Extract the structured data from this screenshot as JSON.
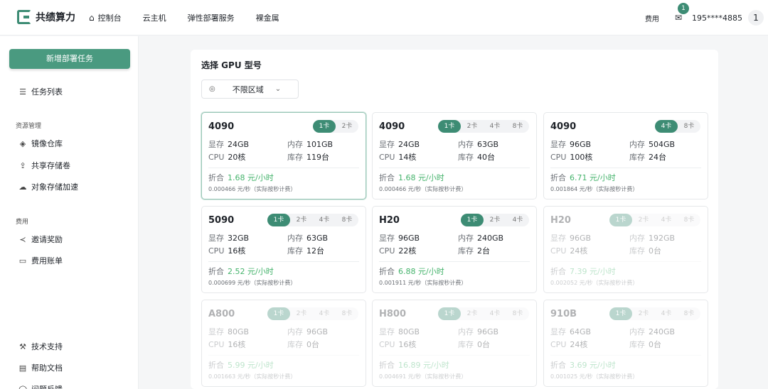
{
  "brand": {
    "name": "共绩算力"
  },
  "nav": [
    {
      "label": "控制台",
      "icon": "home-icon"
    },
    {
      "label": "云主机"
    },
    {
      "label": "弹性部署服务"
    },
    {
      "label": "裸金属"
    }
  ],
  "header": {
    "fee_link": "费用",
    "mail_badge": "1",
    "phone": "195****4885",
    "avatar_text": "1"
  },
  "sidebar": {
    "new_button": "新增部署任务",
    "task_list": "任务列表",
    "section_resources": "资源管理",
    "items_resources": [
      "镜像仓库",
      "共享存储卷",
      "对象存储加速"
    ],
    "section_fees": "费用",
    "items_fees": [
      "邀请奖励",
      "费用账单"
    ],
    "bottom_items": [
      "技术支持",
      "帮助文档",
      "问题反馈"
    ]
  },
  "main": {
    "title": "选择 GPU 型号",
    "region_value": "不限区域",
    "labels": {
      "vram": "显存",
      "mem": "内存",
      "cpu": "CPU",
      "stock": "库存",
      "discount": "折合"
    },
    "cards": [
      {
        "name": "4090",
        "pills": [
          "1卡",
          "2卡"
        ],
        "active": 0,
        "vram": "24GB",
        "mem": "101GB",
        "cpu": "20核",
        "stock": "119台",
        "price": "1.68 元/小时",
        "sub": "0.000466 元/秒（实际按秒计费）",
        "selected": true,
        "disabled": false
      },
      {
        "name": "4090",
        "pills": [
          "1卡",
          "2卡",
          "4卡",
          "8卡"
        ],
        "active": 0,
        "vram": "24GB",
        "mem": "63GB",
        "cpu": "14核",
        "stock": "40台",
        "price": "1.68 元/小时",
        "sub": "0.000466 元/秒（实际按秒计费）",
        "selected": false,
        "disabled": false
      },
      {
        "name": "4090",
        "pills": [
          "4卡",
          "8卡"
        ],
        "active": 0,
        "vram": "96GB",
        "mem": "504GB",
        "cpu": "100核",
        "stock": "24台",
        "price": "6.71 元/小时",
        "sub": "0.001864 元/秒（实际按秒计费）",
        "selected": false,
        "disabled": false
      },
      {
        "name": "5090",
        "pills": [
          "1卡",
          "2卡",
          "4卡",
          "8卡"
        ],
        "active": 0,
        "vram": "32GB",
        "mem": "63GB",
        "cpu": "16核",
        "stock": "12台",
        "price": "2.52 元/小时",
        "sub": "0.000699 元/秒（实际按秒计费）",
        "selected": false,
        "disabled": false
      },
      {
        "name": "H20",
        "pills": [
          "1卡",
          "2卡",
          "4卡"
        ],
        "active": 0,
        "vram": "96GB",
        "mem": "240GB",
        "cpu": "22核",
        "stock": "2台",
        "price": "6.88 元/小时",
        "sub": "0.001911 元/秒（实际按秒计费）",
        "selected": false,
        "disabled": false
      },
      {
        "name": "H20",
        "pills": [
          "1卡",
          "2卡",
          "4卡",
          "8卡"
        ],
        "active": 0,
        "vram": "96GB",
        "mem": "192GB",
        "cpu": "24核",
        "stock": "0台",
        "price": "7.39 元/小时",
        "sub": "0.002052 元/秒（实际按秒计费）",
        "selected": false,
        "disabled": true
      },
      {
        "name": "A800",
        "pills": [
          "1卡",
          "2卡",
          "4卡",
          "8卡"
        ],
        "active": 0,
        "vram": "80GB",
        "mem": "96GB",
        "cpu": "16核",
        "stock": "0台",
        "price": "5.99 元/小时",
        "sub": "0.001663 元/秒（实际按秒计费）",
        "selected": false,
        "disabled": true
      },
      {
        "name": "H800",
        "pills": [
          "1卡",
          "2卡",
          "4卡",
          "8卡"
        ],
        "active": 0,
        "vram": "80GB",
        "mem": "96GB",
        "cpu": "16核",
        "stock": "0台",
        "price": "16.89 元/小时",
        "sub": "0.004691 元/秒（实际按秒计费）",
        "selected": false,
        "disabled": true
      },
      {
        "name": "910B",
        "pills": [
          "1卡",
          "2卡",
          "4卡",
          "8卡"
        ],
        "active": 0,
        "vram": "64GB",
        "mem": "240GB",
        "cpu": "24核",
        "stock": "0台",
        "price": "3.69 元/小时",
        "sub": "0.001025 元/秒（实际按秒计费）",
        "selected": false,
        "disabled": true
      }
    ]
  },
  "colors": {
    "accent": "#3d8c74",
    "price": "#45b36c",
    "button": "#4a9a80"
  }
}
